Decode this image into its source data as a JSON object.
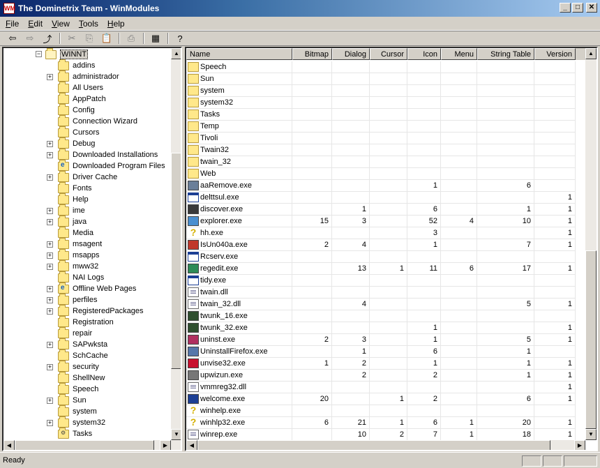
{
  "window": {
    "title": "The Dominetrix Team - WinModules",
    "icon_text": "WM"
  },
  "menu": [
    "File",
    "Edit",
    "View",
    "Tools",
    "Help"
  ],
  "toolbar": {
    "buttons": [
      {
        "name": "back-icon",
        "glyph": "⇦",
        "enabled": true
      },
      {
        "name": "forward-icon",
        "glyph": "⇨",
        "enabled": false
      },
      {
        "name": "up-folder-icon",
        "glyph": "⤴",
        "enabled": true
      },
      {
        "name": "cut-icon",
        "glyph": "✂",
        "enabled": false
      },
      {
        "name": "copy-icon",
        "glyph": "⎘",
        "enabled": false
      },
      {
        "name": "paste-icon",
        "glyph": "📋",
        "enabled": false
      },
      {
        "name": "print-icon",
        "glyph": "⎙",
        "enabled": false
      },
      {
        "name": "details-view-icon",
        "glyph": "▦",
        "enabled": true
      },
      {
        "name": "help-icon",
        "glyph": "?",
        "enabled": true
      }
    ]
  },
  "tree": {
    "root": "WINNT",
    "items": [
      {
        "label": "addins",
        "expander": false,
        "icon": "folder"
      },
      {
        "label": "administrador",
        "expander": true,
        "icon": "folder"
      },
      {
        "label": "All Users",
        "expander": false,
        "icon": "folder"
      },
      {
        "label": "AppPatch",
        "expander": false,
        "icon": "folder"
      },
      {
        "label": "Config",
        "expander": false,
        "icon": "folder"
      },
      {
        "label": "Connection Wizard",
        "expander": false,
        "icon": "folder"
      },
      {
        "label": "Cursors",
        "expander": false,
        "icon": "folder"
      },
      {
        "label": "Debug",
        "expander": true,
        "icon": "folder"
      },
      {
        "label": "Downloaded Installations",
        "expander": true,
        "icon": "folder"
      },
      {
        "label": "Downloaded Program Files",
        "expander": false,
        "icon": "web"
      },
      {
        "label": "Driver Cache",
        "expander": true,
        "icon": "folder"
      },
      {
        "label": "Fonts",
        "expander": false,
        "icon": "folder"
      },
      {
        "label": "Help",
        "expander": false,
        "icon": "folder"
      },
      {
        "label": "ime",
        "expander": true,
        "icon": "folder"
      },
      {
        "label": "java",
        "expander": true,
        "icon": "folder"
      },
      {
        "label": "Media",
        "expander": false,
        "icon": "folder"
      },
      {
        "label": "msagent",
        "expander": true,
        "icon": "folder"
      },
      {
        "label": "msapps",
        "expander": true,
        "icon": "folder"
      },
      {
        "label": "mww32",
        "expander": true,
        "icon": "folder"
      },
      {
        "label": "NAI Logs",
        "expander": false,
        "icon": "folder"
      },
      {
        "label": "Offline Web Pages",
        "expander": true,
        "icon": "web"
      },
      {
        "label": "perfiles",
        "expander": true,
        "icon": "folder"
      },
      {
        "label": "RegisteredPackages",
        "expander": true,
        "icon": "folder"
      },
      {
        "label": "Registration",
        "expander": false,
        "icon": "folder"
      },
      {
        "label": "repair",
        "expander": false,
        "icon": "folder"
      },
      {
        "label": "SAPwksta",
        "expander": true,
        "icon": "folder"
      },
      {
        "label": "SchCache",
        "expander": false,
        "icon": "folder"
      },
      {
        "label": "security",
        "expander": true,
        "icon": "folder"
      },
      {
        "label": "ShellNew",
        "expander": false,
        "icon": "folder"
      },
      {
        "label": "Speech",
        "expander": false,
        "icon": "folder"
      },
      {
        "label": "Sun",
        "expander": true,
        "icon": "folder"
      },
      {
        "label": "system",
        "expander": false,
        "icon": "folder"
      },
      {
        "label": "system32",
        "expander": true,
        "icon": "folder"
      },
      {
        "label": "Tasks",
        "expander": false,
        "icon": "special"
      }
    ]
  },
  "list": {
    "columns": [
      "Name",
      "Bitmap",
      "Dialog",
      "Cursor",
      "Icon",
      "Menu",
      "String Table",
      "Version"
    ],
    "rows": [
      {
        "name": "Speech",
        "icon": "folder",
        "v": [
          "",
          "",
          "",
          "",
          "",
          "",
          ""
        ]
      },
      {
        "name": "Sun",
        "icon": "folder",
        "v": [
          "",
          "",
          "",
          "",
          "",
          "",
          ""
        ]
      },
      {
        "name": "system",
        "icon": "folder",
        "v": [
          "",
          "",
          "",
          "",
          "",
          "",
          ""
        ]
      },
      {
        "name": "system32",
        "icon": "folder",
        "v": [
          "",
          "",
          "",
          "",
          "",
          "",
          ""
        ]
      },
      {
        "name": "Tasks",
        "icon": "folder",
        "v": [
          "",
          "",
          "",
          "",
          "",
          "",
          ""
        ]
      },
      {
        "name": "Temp",
        "icon": "folder",
        "v": [
          "",
          "",
          "",
          "",
          "",
          "",
          ""
        ]
      },
      {
        "name": "Tivoli",
        "icon": "folder",
        "v": [
          "",
          "",
          "",
          "",
          "",
          "",
          ""
        ]
      },
      {
        "name": "Twain32",
        "icon": "folder",
        "v": [
          "",
          "",
          "",
          "",
          "",
          "",
          ""
        ]
      },
      {
        "name": "twain_32",
        "icon": "folder",
        "v": [
          "",
          "",
          "",
          "",
          "",
          "",
          ""
        ]
      },
      {
        "name": "Web",
        "icon": "folder",
        "v": [
          "",
          "",
          "",
          "",
          "",
          "",
          ""
        ]
      },
      {
        "name": "aaRemove.exe",
        "icon": "color",
        "color": "#6b7f99",
        "v": [
          "",
          "",
          "",
          "1",
          "",
          "6",
          ""
        ]
      },
      {
        "name": "delttsul.exe",
        "icon": "exe",
        "v": [
          "",
          "",
          "",
          "",
          "",
          "",
          "1"
        ]
      },
      {
        "name": "discover.exe",
        "icon": "color",
        "color": "#3a3a3a",
        "v": [
          "",
          "1",
          "",
          "6",
          "",
          "1",
          "1"
        ]
      },
      {
        "name": "explorer.exe",
        "icon": "color",
        "color": "#4a8fd0",
        "v": [
          "15",
          "3",
          "",
          "52",
          "4",
          "10",
          "1"
        ]
      },
      {
        "name": "hh.exe",
        "icon": "help",
        "v": [
          "",
          "",
          "",
          "3",
          "",
          "",
          "1"
        ]
      },
      {
        "name": "IsUn040a.exe",
        "icon": "color",
        "color": "#c0392b",
        "v": [
          "2",
          "4",
          "",
          "1",
          "",
          "7",
          "1"
        ]
      },
      {
        "name": "Rcserv.exe",
        "icon": "exe",
        "v": [
          "",
          "",
          "",
          "",
          "",
          "",
          ""
        ]
      },
      {
        "name": "regedit.exe",
        "icon": "color",
        "color": "#2e8b57",
        "v": [
          "",
          "13",
          "1",
          "11",
          "6",
          "17",
          "1"
        ]
      },
      {
        "name": "tidy.exe",
        "icon": "exe",
        "v": [
          "",
          "",
          "",
          "",
          "",
          "",
          ""
        ]
      },
      {
        "name": "twain.dll",
        "icon": "dll",
        "v": [
          "",
          "",
          "",
          "",
          "",
          "",
          ""
        ]
      },
      {
        "name": "twain_32.dll",
        "icon": "dll",
        "v": [
          "",
          "4",
          "",
          "",
          "",
          "5",
          "1"
        ]
      },
      {
        "name": "twunk_16.exe",
        "icon": "color",
        "color": "#2f4f2f",
        "v": [
          "",
          "",
          "",
          "",
          "",
          "",
          ""
        ]
      },
      {
        "name": "twunk_32.exe",
        "icon": "color",
        "color": "#2f4f2f",
        "v": [
          "",
          "",
          "",
          "1",
          "",
          "",
          "1"
        ]
      },
      {
        "name": "uninst.exe",
        "icon": "color",
        "color": "#b03060",
        "v": [
          "2",
          "3",
          "",
          "1",
          "",
          "5",
          "1"
        ]
      },
      {
        "name": "UninstallFirefox.exe",
        "icon": "color",
        "color": "#5577aa",
        "v": [
          "",
          "1",
          "",
          "6",
          "",
          "1",
          ""
        ]
      },
      {
        "name": "unvise32.exe",
        "icon": "color",
        "color": "#c8102e",
        "v": [
          "1",
          "2",
          "",
          "1",
          "",
          "1",
          "1"
        ]
      },
      {
        "name": "upwizun.exe",
        "icon": "color",
        "color": "#777777",
        "v": [
          "",
          "2",
          "",
          "2",
          "",
          "1",
          "1"
        ]
      },
      {
        "name": "vmmreg32.dll",
        "icon": "dll",
        "v": [
          "",
          "",
          "",
          "",
          "",
          "",
          "1"
        ]
      },
      {
        "name": "welcome.exe",
        "icon": "color",
        "color": "#1c3f94",
        "v": [
          "20",
          "",
          "1",
          "2",
          "",
          "6",
          "1"
        ]
      },
      {
        "name": "winhelp.exe",
        "icon": "help",
        "v": [
          "",
          "",
          "",
          "",
          "",
          "",
          ""
        ]
      },
      {
        "name": "winhlp32.exe",
        "icon": "help",
        "v": [
          "6",
          "21",
          "1",
          "6",
          "1",
          "20",
          "1"
        ]
      },
      {
        "name": "winrep.exe",
        "icon": "dll",
        "v": [
          "",
          "10",
          "2",
          "7",
          "1",
          "18",
          "1"
        ]
      }
    ]
  },
  "status": {
    "text": "Ready"
  }
}
